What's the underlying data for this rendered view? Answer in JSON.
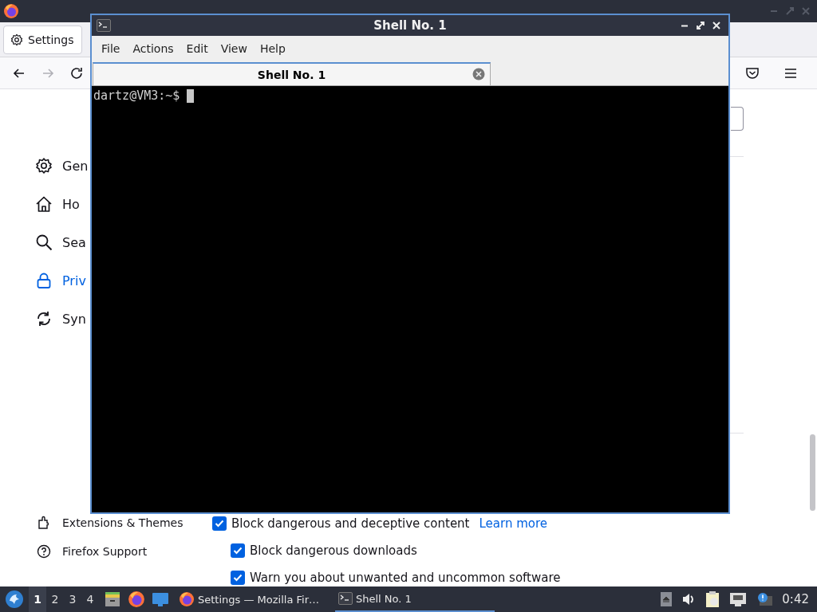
{
  "browser": {
    "tab": {
      "label": "Settings"
    },
    "navigation": [
      {
        "kind": "back",
        "disabled": false
      },
      {
        "kind": "forward",
        "disabled": true
      },
      {
        "kind": "reload",
        "disabled": false
      }
    ],
    "sidebar": {
      "items": [
        {
          "label": "Gen",
          "selected": false
        },
        {
          "label": "Ho",
          "selected": false
        },
        {
          "label": "Sea",
          "selected": false
        },
        {
          "label": "Priv",
          "selected": true
        },
        {
          "label": "Syn",
          "selected": false
        }
      ],
      "footer_items": [
        {
          "label": "Extensions & Themes"
        },
        {
          "label": "Firefox Support"
        }
      ]
    },
    "settings": [
      {
        "label": "Block dangerous and deceptive content",
        "checked": true,
        "link": "Learn more",
        "children": [
          {
            "label": "Block dangerous downloads",
            "checked": true
          },
          {
            "label": "Warn you about unwanted and uncommon software",
            "checked": true
          }
        ]
      }
    ]
  },
  "terminal": {
    "title": "Shell No. 1",
    "menu": [
      "File",
      "Actions",
      "Edit",
      "View",
      "Help"
    ],
    "tabs": [
      {
        "label": "Shell No. 1",
        "selected": true
      }
    ],
    "lines": [
      "dartz@VM3:~$"
    ]
  },
  "taskbar": {
    "workspaces": [
      {
        "label": "1",
        "selected": true
      },
      {
        "label": "2",
        "selected": false
      },
      {
        "label": "3",
        "selected": false
      },
      {
        "label": "4",
        "selected": false
      }
    ],
    "tasks": [
      {
        "label": "Settings — Mozilla Fir…",
        "kind": "browser",
        "selected": false
      },
      {
        "label": "Shell No. 1",
        "kind": "terminal",
        "selected": true
      }
    ],
    "clock": "0:42"
  }
}
